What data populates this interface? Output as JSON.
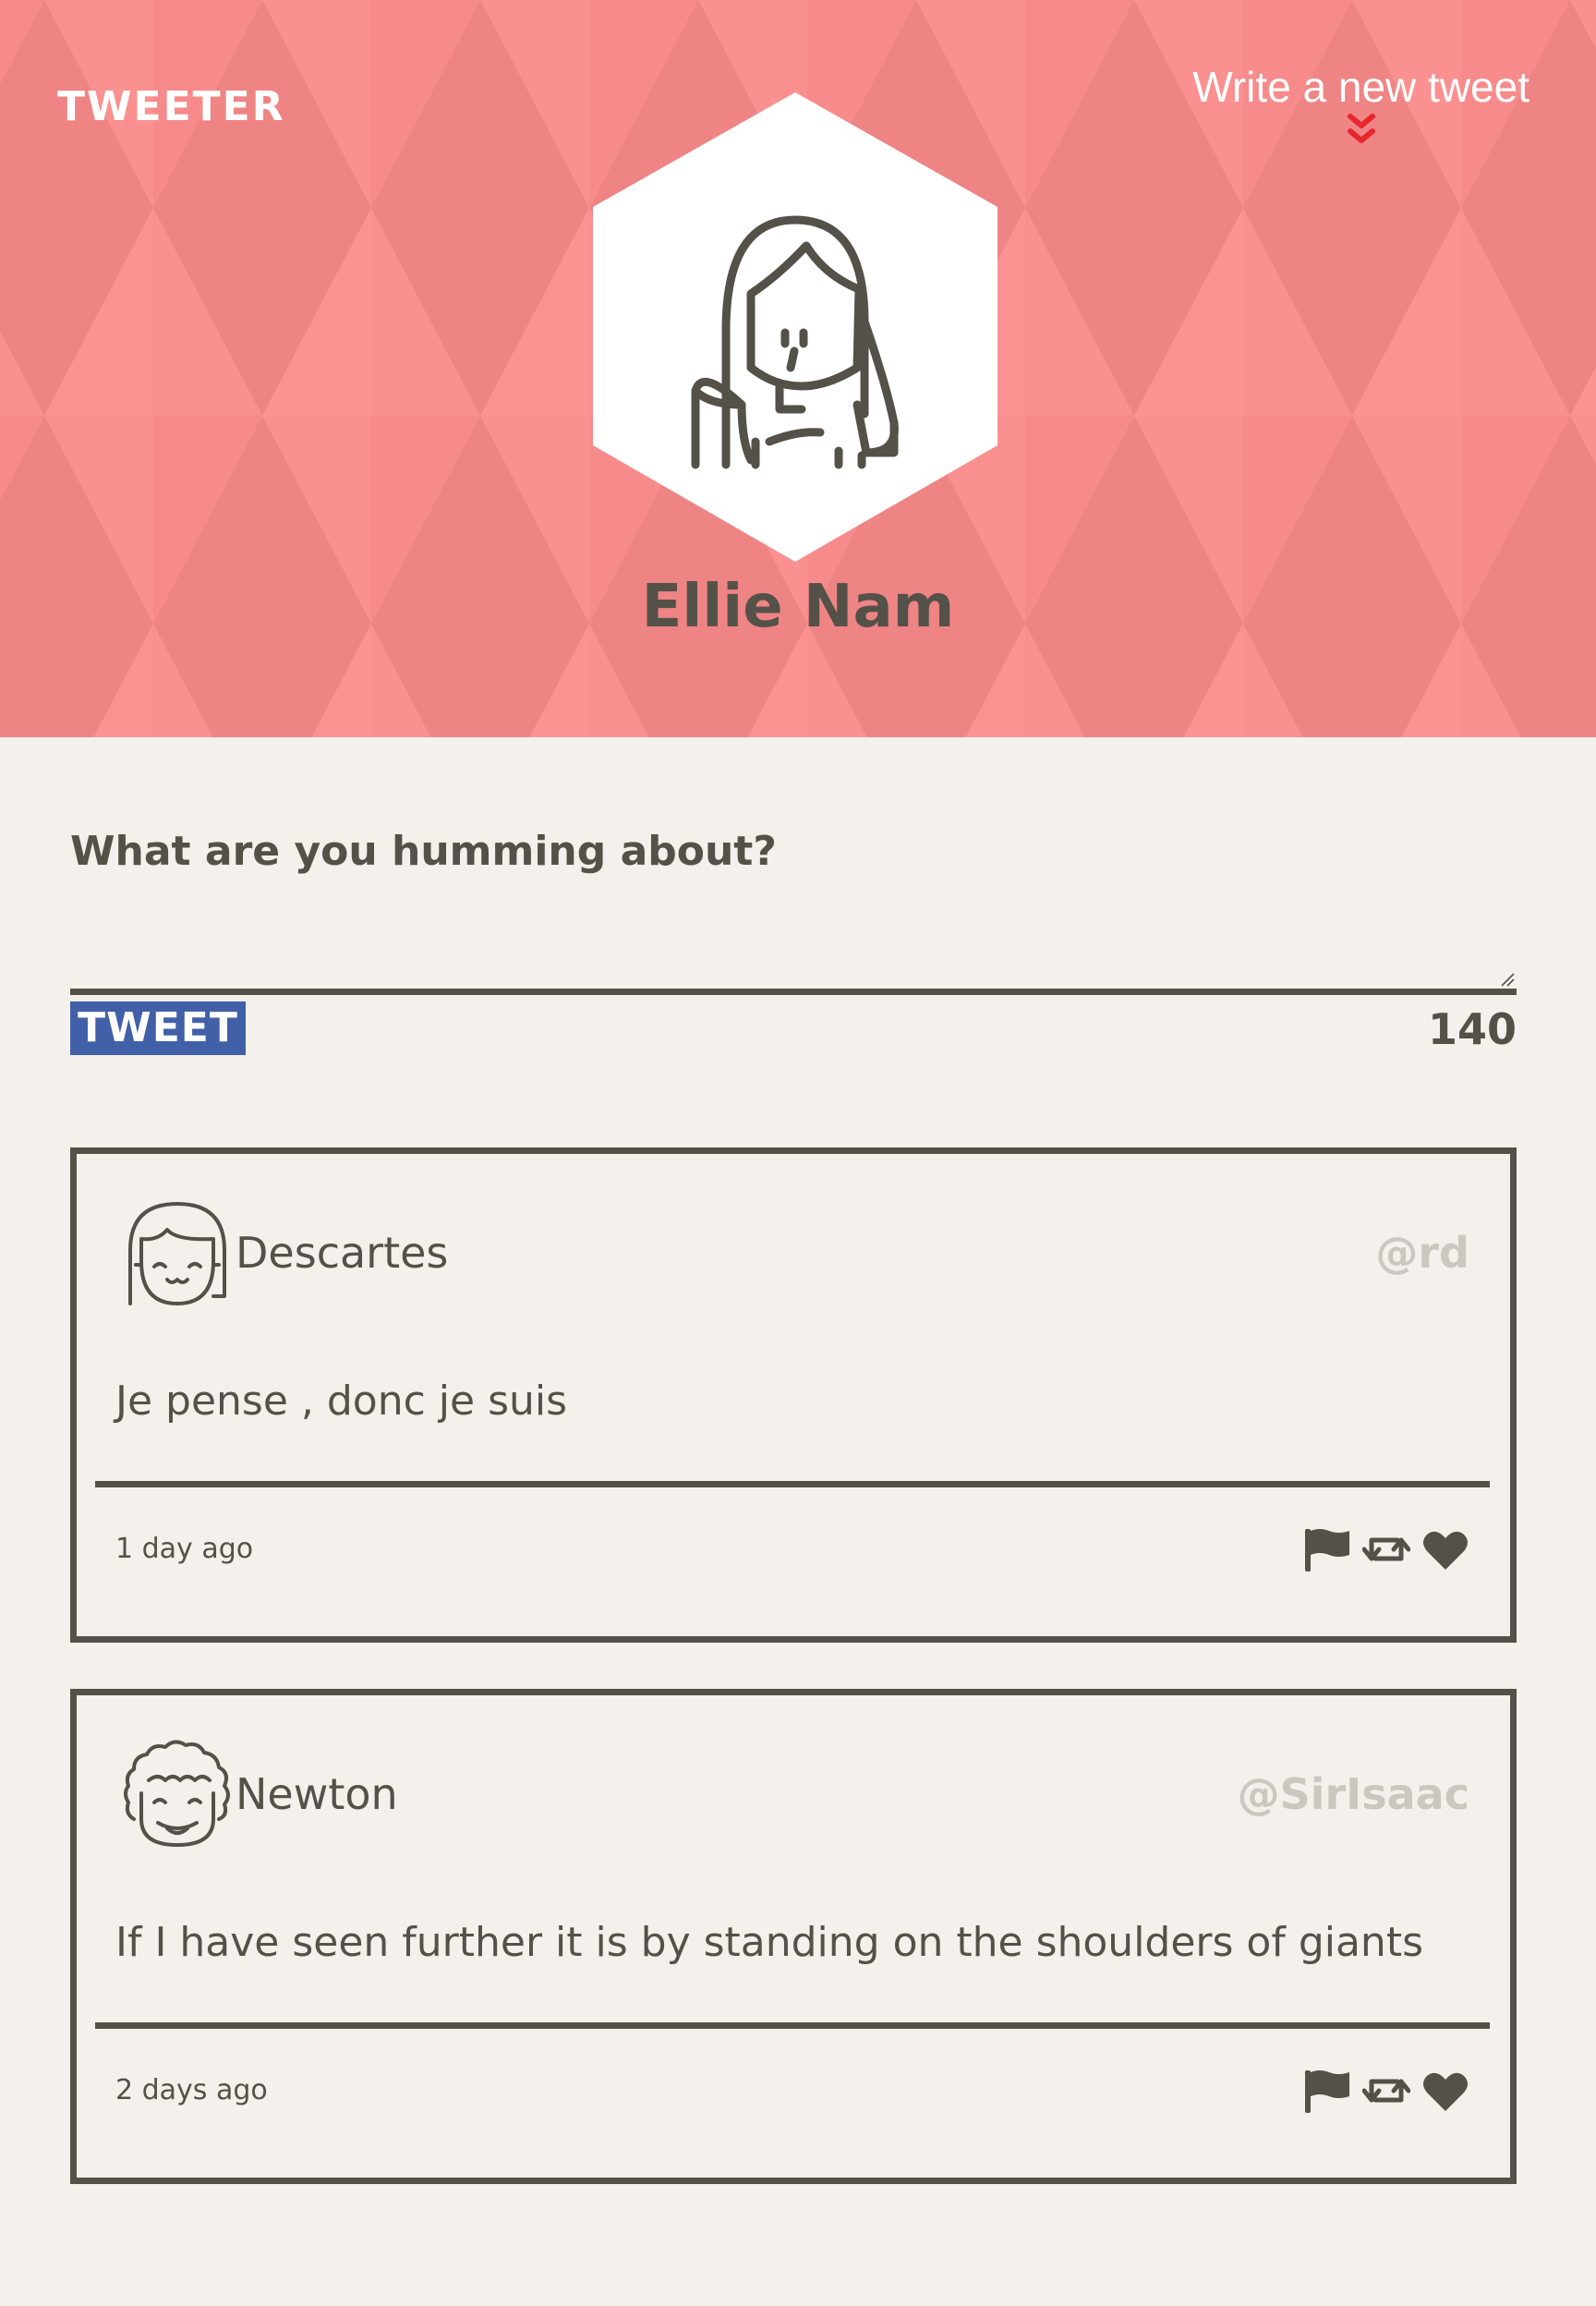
{
  "header": {
    "brand": "TWEETER",
    "write_link": "Write a new tweet",
    "profile_name": "Ellie Nam"
  },
  "compose": {
    "label": "What are you humming about?",
    "textarea_value": "",
    "button_label": "TWEET",
    "counter": "140"
  },
  "tweets": [
    {
      "author": "Descartes",
      "handle": "@rd",
      "text": "Je pense , donc je suis",
      "time": "1 day ago",
      "avatar_icon": "girl-avatar-icon"
    },
    {
      "author": "Newton",
      "handle": "@SirIsaac",
      "text": "If I have seen further it is by standing on the shoulders of giants",
      "time": "2 days ago",
      "avatar_icon": "curly-hair-avatar-icon"
    }
  ],
  "icons": {
    "write_arrow": "double-chevron-down-icon",
    "flag": "flag-icon",
    "retweet": "retweet-icon",
    "like": "heart-icon"
  },
  "colors": {
    "header_bg": "#f98f8f",
    "accent_red": "#e8262e",
    "button_blue": "#4160a8",
    "text_dark": "#545149",
    "handle_gray": "#cbc7c1",
    "page_bg": "#f4f1ec"
  }
}
